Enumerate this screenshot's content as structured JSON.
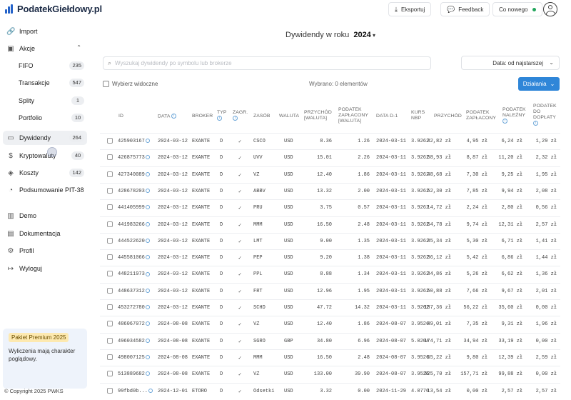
{
  "app": {
    "name": "PodatekGiełdowy.pl",
    "brand_color": "#2563c9"
  },
  "topbar": {
    "export_label": "Eksportuj",
    "feedback_label": "Feedback",
    "whats_new_label": "Co nowego"
  },
  "sidebar": {
    "import": "Import",
    "akcje": "Akcje",
    "fifo": {
      "label": "FIFO",
      "count": "235"
    },
    "transakcje": {
      "label": "Transakcje",
      "count": "547"
    },
    "splity": {
      "label": "Splity",
      "count": "1"
    },
    "portfolio": {
      "label": "Portfolio",
      "count": "10"
    },
    "dywidendy": {
      "label": "Dywidendy",
      "count": "264"
    },
    "kryptowaluty": {
      "label": "Kryptowaluty",
      "count": "40"
    },
    "koszty": {
      "label": "Koszty",
      "count": "142"
    },
    "pit": "Podsumowanie PIT-38",
    "demo": "Demo",
    "dokumentacja": "Dokumentacja",
    "profil": "Profil",
    "wyloguj": "Wyloguj",
    "promo_badge": "Pakiet Premium 2025",
    "promo_text": "Wyliczenia mają charakter poglądowy.",
    "copyright": "© Copyright 2025 PWKS"
  },
  "main": {
    "title_prefix": "Dywidendy w roku",
    "year": "2024",
    "search_placeholder": "Wyszukaj dywidendy po symbolu lub brokerze",
    "sort_label": "Data: od najstarszej",
    "select_visible": "Wybierz widoczne",
    "selected_count": "Wybrano: 0 elementów",
    "actions_label": "Działania"
  },
  "table": {
    "headers": {
      "id": "ID",
      "data": "DATA",
      "broker": "BROKER",
      "typ": "TYP",
      "zagr": "ZAGR.",
      "zasob": "ZASÓB",
      "waluta": "WALUTA",
      "przychod_w1": "PRZYCHÓD",
      "przychod_w2": "[WALUTA]",
      "podz_w1": "PODATEK",
      "podz_w2": "ZAPŁACONY",
      "podz_w3": "[WALUTA]",
      "datad1": "DATA D-1",
      "kurs_w1": "KURS",
      "kurs_w2": "NBP",
      "przychod_pln": "PRZYCHÓD",
      "pzpl_w1": "PODATEK",
      "pzpl_w2": "ZAPŁACONY",
      "pnal_w1": "PODATEK",
      "pnal_w2": "NALEŻNY",
      "pdop_w1": "PODATEK",
      "pdop_w2": "DO",
      "pdop_w3": "DOPŁATY"
    },
    "rows": [
      {
        "id": "425903167",
        "date": "2024-03-12",
        "broker": "EXANTE",
        "type": "D",
        "foreign": "✓",
        "asset": "CSCO",
        "currency": "USD",
        "income": "8.36",
        "tax": "1.26",
        "date_d1": "2024-03-11",
        "rate": "3.9262",
        "income_pln": "32,82 zł",
        "tax_paid_pln": "4,95 zł",
        "tax_due_pln": "6,24 zł",
        "tax_extra_pln": "1,29 zł"
      },
      {
        "id": "426875773",
        "date": "2024-03-12",
        "broker": "EXANTE",
        "type": "D",
        "foreign": "✓",
        "asset": "UVV",
        "currency": "USD",
        "income": "15.01",
        "tax": "2.26",
        "date_d1": "2024-03-11",
        "rate": "3.9262",
        "income_pln": "58,93 zł",
        "tax_paid_pln": "8,87 zł",
        "tax_due_pln": "11,20 zł",
        "tax_extra_pln": "2,32 zł"
      },
      {
        "id": "427340089",
        "date": "2024-03-12",
        "broker": "EXANTE",
        "type": "D",
        "foreign": "✓",
        "asset": "VZ",
        "currency": "USD",
        "income": "12.40",
        "tax": "1.86",
        "date_d1": "2024-03-11",
        "rate": "3.9262",
        "income_pln": "48,68 zł",
        "tax_paid_pln": "7,30 zł",
        "tax_due_pln": "9,25 zł",
        "tax_extra_pln": "1,95 zł"
      },
      {
        "id": "428678203",
        "date": "2024-03-12",
        "broker": "EXANTE",
        "type": "D",
        "foreign": "✓",
        "asset": "ABBV",
        "currency": "USD",
        "income": "13.32",
        "tax": "2.00",
        "date_d1": "2024-03-11",
        "rate": "3.9262",
        "income_pln": "52,30 zł",
        "tax_paid_pln": "7,85 zł",
        "tax_due_pln": "9,94 zł",
        "tax_extra_pln": "2,08 zł"
      },
      {
        "id": "441405999",
        "date": "2024-03-12",
        "broker": "EXANTE",
        "type": "D",
        "foreign": "✓",
        "asset": "PRU",
        "currency": "USD",
        "income": "3.75",
        "tax": "0.57",
        "date_d1": "2024-03-11",
        "rate": "3.9262",
        "income_pln": "14,72 zł",
        "tax_paid_pln": "2,24 zł",
        "tax_due_pln": "2,80 zł",
        "tax_extra_pln": "0,56 zł"
      },
      {
        "id": "441983266",
        "date": "2024-03-12",
        "broker": "EXANTE",
        "type": "D",
        "foreign": "✓",
        "asset": "MMM",
        "currency": "USD",
        "income": "16.50",
        "tax": "2.48",
        "date_d1": "2024-03-11",
        "rate": "3.9262",
        "income_pln": "64,78 zł",
        "tax_paid_pln": "9,74 zł",
        "tax_due_pln": "12,31 zł",
        "tax_extra_pln": "2,57 zł"
      },
      {
        "id": "444522620",
        "date": "2024-03-12",
        "broker": "EXANTE",
        "type": "D",
        "foreign": "✓",
        "asset": "LMT",
        "currency": "USD",
        "income": "9.00",
        "tax": "1.35",
        "date_d1": "2024-03-11",
        "rate": "3.9262",
        "income_pln": "35,34 zł",
        "tax_paid_pln": "5,30 zł",
        "tax_due_pln": "6,71 zł",
        "tax_extra_pln": "1,41 zł"
      },
      {
        "id": "445581066",
        "date": "2024-03-12",
        "broker": "EXANTE",
        "type": "D",
        "foreign": "✓",
        "asset": "PEP",
        "currency": "USD",
        "income": "9.20",
        "tax": "1.38",
        "date_d1": "2024-03-11",
        "rate": "3.9262",
        "income_pln": "36,12 zł",
        "tax_paid_pln": "5,42 zł",
        "tax_due_pln": "6,86 zł",
        "tax_extra_pln": "1,44 zł"
      },
      {
        "id": "448211973",
        "date": "2024-03-12",
        "broker": "EXANTE",
        "type": "D",
        "foreign": "✓",
        "asset": "PPL",
        "currency": "USD",
        "income": "8.88",
        "tax": "1.34",
        "date_d1": "2024-03-11",
        "rate": "3.9262",
        "income_pln": "34,86 zł",
        "tax_paid_pln": "5,26 zł",
        "tax_due_pln": "6,62 zł",
        "tax_extra_pln": "1,36 zł"
      },
      {
        "id": "448637312",
        "date": "2024-03-12",
        "broker": "EXANTE",
        "type": "D",
        "foreign": "✓",
        "asset": "FRT",
        "currency": "USD",
        "income": "12.96",
        "tax": "1.95",
        "date_d1": "2024-03-11",
        "rate": "3.9262",
        "income_pln": "50,88 zł",
        "tax_paid_pln": "7,66 zł",
        "tax_due_pln": "9,67 zł",
        "tax_extra_pln": "2,01 zł"
      },
      {
        "id": "453272780",
        "date": "2024-03-12",
        "broker": "EXANTE",
        "type": "D",
        "foreign": "✓",
        "asset": "SCHD",
        "currency": "USD",
        "income": "47.72",
        "tax": "14.32",
        "date_d1": "2024-03-11",
        "rate": "3.9262",
        "income_pln": "187,36 zł",
        "tax_paid_pln": "56,22 zł",
        "tax_due_pln": "35,60 zł",
        "tax_extra_pln": "0,00 zł"
      },
      {
        "id": "486067072",
        "date": "2024-08-08",
        "broker": "EXANTE",
        "type": "D",
        "foreign": "✓",
        "asset": "VZ",
        "currency": "USD",
        "income": "12.40",
        "tax": "1.86",
        "date_d1": "2024-08-07",
        "rate": "3.9526",
        "income_pln": "49,01 zł",
        "tax_paid_pln": "7,35 zł",
        "tax_due_pln": "9,31 zł",
        "tax_extra_pln": "1,96 zł"
      },
      {
        "id": "496034582",
        "date": "2024-08-08",
        "broker": "EXANTE",
        "type": "D",
        "foreign": "✓",
        "asset": "SGRO",
        "currency": "GBP",
        "income": "34.80",
        "tax": "6.96",
        "date_d1": "2024-08-07",
        "rate": "5.0204",
        "income_pln": "174,71 zł",
        "tax_paid_pln": "34,94 zł",
        "tax_due_pln": "33,19 zł",
        "tax_extra_pln": "0,00 zł"
      },
      {
        "id": "498007125",
        "date": "2024-08-08",
        "broker": "EXANTE",
        "type": "D",
        "foreign": "✓",
        "asset": "MMM",
        "currency": "USD",
        "income": "16.50",
        "tax": "2.48",
        "date_d1": "2024-08-07",
        "rate": "3.9526",
        "income_pln": "65,22 zł",
        "tax_paid_pln": "9,80 zł",
        "tax_due_pln": "12,39 zł",
        "tax_extra_pln": "2,59 zł"
      },
      {
        "id": "513889682",
        "date": "2024-08-08",
        "broker": "EXANTE",
        "type": "D",
        "foreign": "✓",
        "asset": "VZ",
        "currency": "USD",
        "income": "133.00",
        "tax": "39.90",
        "date_d1": "2024-08-07",
        "rate": "3.9526",
        "income_pln": "525,70 zł",
        "tax_paid_pln": "157,71 zł",
        "tax_due_pln": "99,88 zł",
        "tax_extra_pln": "0,00 zł"
      },
      {
        "id": "99fbd0b...",
        "date": "2024-12-01",
        "broker": "ETORO",
        "type": "D",
        "foreign": "✓",
        "asset": "Odsetki",
        "currency": "USD",
        "income": "3.32",
        "tax": "0.00",
        "date_d1": "2024-11-29",
        "rate": "4.0770",
        "income_pln": "13,54 zł",
        "tax_paid_pln": "0,00 zł",
        "tax_due_pln": "2,57 zł",
        "tax_extra_pln": "2,57 zł"
      }
    ]
  }
}
